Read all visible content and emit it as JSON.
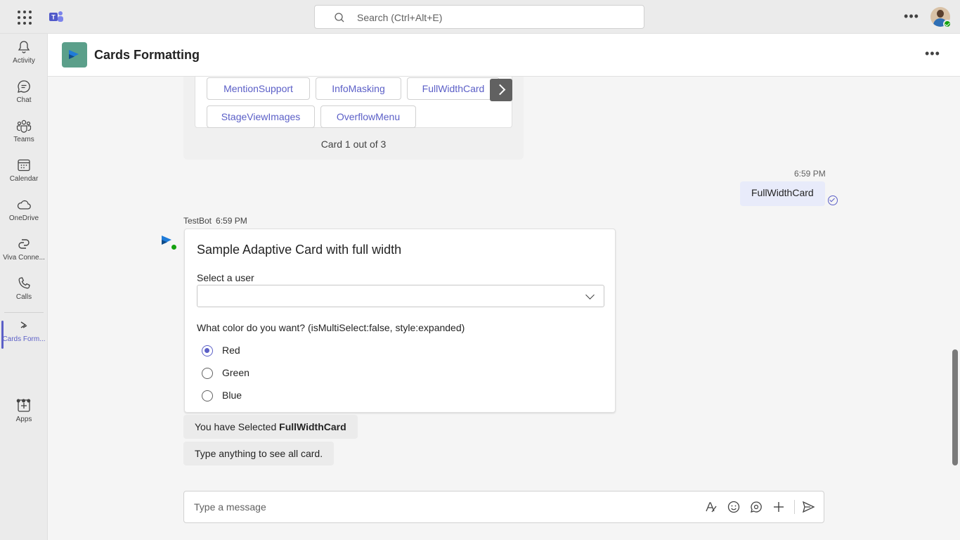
{
  "search": {
    "placeholder": "Search (Ctrl+Alt+E)"
  },
  "rail": {
    "items": [
      {
        "label": "Activity",
        "icon": "bell-icon"
      },
      {
        "label": "Chat",
        "icon": "chat-icon"
      },
      {
        "label": "Teams",
        "icon": "teams-icon"
      },
      {
        "label": "Calendar",
        "icon": "calendar-icon"
      },
      {
        "label": "OneDrive",
        "icon": "cloud-icon"
      },
      {
        "label": "Viva Conne...",
        "icon": "viva-icon"
      },
      {
        "label": "Calls",
        "icon": "phone-icon"
      },
      {
        "label": "Cards Form...",
        "icon": "cards-app-icon"
      },
      {
        "label": "Apps",
        "icon": "add-apps-icon"
      }
    ],
    "more": "•••"
  },
  "header": {
    "title": "Cards Formatting",
    "more": "•••"
  },
  "carousel": {
    "chips_row1": [
      "MentionSupport",
      "InfoMasking",
      "FullWidthCard"
    ],
    "chips_row2": [
      "StageViewImages",
      "OverflowMenu"
    ],
    "footer": "Card 1 out of 3"
  },
  "my_message": {
    "time": "6:59 PM",
    "text": "FullWidthCard"
  },
  "bot": {
    "name": "TestBot",
    "time": "6:59 PM"
  },
  "card": {
    "title": "Sample Adaptive Card with full width",
    "select_label": "Select a user",
    "select_value": "",
    "color_question": "What color do you want? (isMultiSelect:false, style:expanded)",
    "options": [
      {
        "label": "Red",
        "checked": true
      },
      {
        "label": "Green",
        "checked": false
      },
      {
        "label": "Blue",
        "checked": false
      }
    ]
  },
  "bot_messages": {
    "selected_prefix": "You have Selected ",
    "selected_value": "FullWidthCard",
    "type_anything": "Type anything to see all card."
  },
  "composer": {
    "placeholder": "Type a message"
  },
  "colors": {
    "accent": "#5b5fc7",
    "presence": "#13a10e"
  }
}
